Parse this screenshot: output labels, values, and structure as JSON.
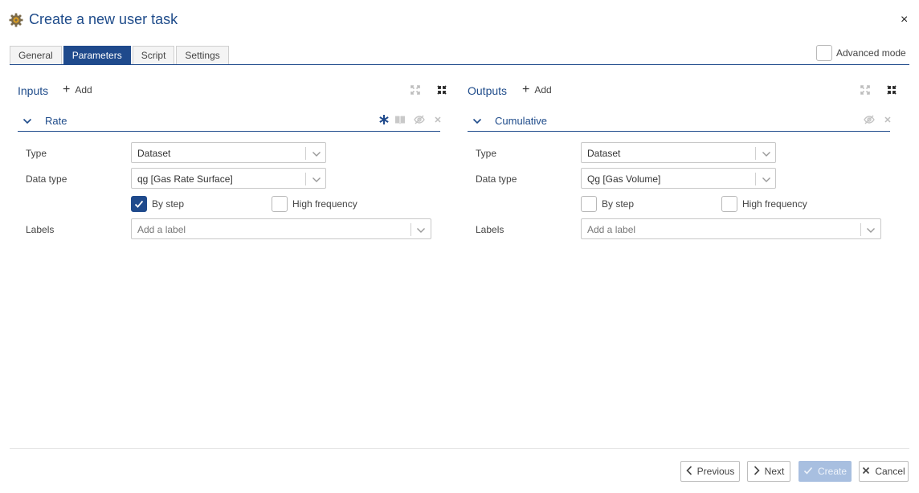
{
  "window": {
    "title": "Create a new user task",
    "icon": "gear-icon",
    "close_label": "×"
  },
  "tabs": [
    {
      "label": "General",
      "active": false
    },
    {
      "label": "Parameters",
      "active": true
    },
    {
      "label": "Script",
      "active": false
    },
    {
      "label": "Settings",
      "active": false
    }
  ],
  "advanced_mode": {
    "label": "Advanced mode",
    "checked": false
  },
  "inputs": {
    "title": "Inputs",
    "add_label": "Add",
    "item": {
      "name": "Rate",
      "type_label": "Type",
      "type_value": "Dataset",
      "datatype_label": "Data type",
      "datatype_value": "qg [Gas Rate Surface]",
      "by_step_label": "By step",
      "by_step_checked": true,
      "high_freq_label": "High frequency",
      "high_freq_checked": false,
      "labels_label": "Labels",
      "labels_placeholder": "Add a label"
    }
  },
  "outputs": {
    "title": "Outputs",
    "add_label": "Add",
    "item": {
      "name": "Cumulative",
      "type_label": "Type",
      "type_value": "Dataset",
      "datatype_label": "Data type",
      "datatype_value": "Qg [Gas Volume]",
      "by_step_label": "By step",
      "by_step_checked": false,
      "high_freq_label": "High frequency",
      "high_freq_checked": false,
      "labels_label": "Labels",
      "labels_placeholder": "Add a label"
    }
  },
  "footer": {
    "previous_label": "Previous",
    "next_label": "Next",
    "create_label": "Create",
    "cancel_label": "Cancel"
  },
  "colors": {
    "accent": "#1f4a8c",
    "title": "#1e4b8a",
    "disabled_button": "#a8bfe0"
  }
}
